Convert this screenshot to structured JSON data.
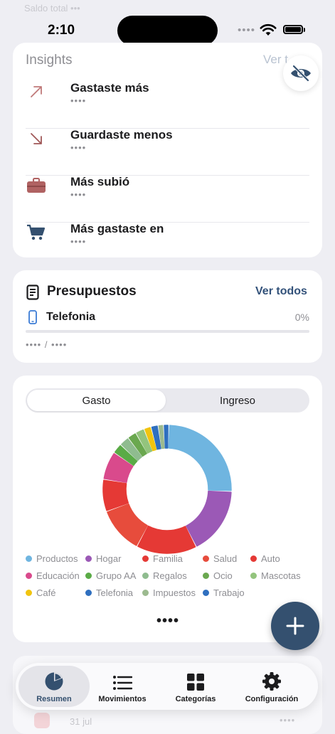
{
  "status_bar": {
    "time": "2:10",
    "ghost_header": "Saldo total •••"
  },
  "insights": {
    "title": "Insights",
    "link": "Ver t",
    "items": [
      {
        "label": "Gastaste más",
        "value": "••••",
        "icon": "arrow-up-right-icon",
        "color": "#c07a7a"
      },
      {
        "label": "Guardaste menos",
        "value": "••••",
        "icon": "arrow-down-right-icon",
        "color": "#a05858"
      },
      {
        "label": "Más subió",
        "value": "••••",
        "icon": "briefcase-icon",
        "color": "#b06262"
      },
      {
        "label": "Más gastaste en",
        "value": "••••",
        "icon": "cart-icon",
        "color": "#34506f"
      }
    ]
  },
  "budgets": {
    "title": "Presupuestos",
    "link": "Ver todos",
    "item": {
      "name": "Telefonia",
      "percent": "0%",
      "progress": 0,
      "amount": "•••• / ••••"
    }
  },
  "chart_toggle": {
    "options": [
      "Gasto",
      "Ingreso"
    ],
    "selected": "Gasto"
  },
  "chart_data": {
    "type": "pie",
    "categories": [
      "Productos",
      "Hogar",
      "Familia",
      "Salud",
      "Auto",
      "Educación",
      "Grupo AA",
      "Regalos",
      "Ocio",
      "Mascotas",
      "Café",
      "Telefonia",
      "Impuestos",
      "Trabajo"
    ],
    "values": [
      28,
      19,
      17,
      13,
      9,
      8,
      2.8,
      2.8,
      2.5,
      2.5,
      2.0,
      2.0,
      1.5,
      1.5
    ],
    "colors": [
      "#6fb5e0",
      "#9b59b6",
      "#e53935",
      "#e74c3c",
      "#e53935",
      "#d94a8c",
      "#5aab46",
      "#8fbc8f",
      "#6aa84f",
      "#93c47d",
      "#f1c40f",
      "#2f6fbf",
      "#9cba8f",
      "#2f6fbf"
    ]
  },
  "chart_total": "••••",
  "recent": {
    "date": "31 jul",
    "amount": "••••"
  },
  "tabs": [
    {
      "label": "Resumen",
      "icon": "pie-chart-icon",
      "active": true
    },
    {
      "label": "Movimientos",
      "icon": "list-icon",
      "active": false
    },
    {
      "label": "Categorías",
      "icon": "grid-icon",
      "active": false
    },
    {
      "label": "Configuración",
      "icon": "gear-icon",
      "active": false
    }
  ],
  "colors": {
    "accent": "#34506f",
    "background": "#eeeef3"
  }
}
